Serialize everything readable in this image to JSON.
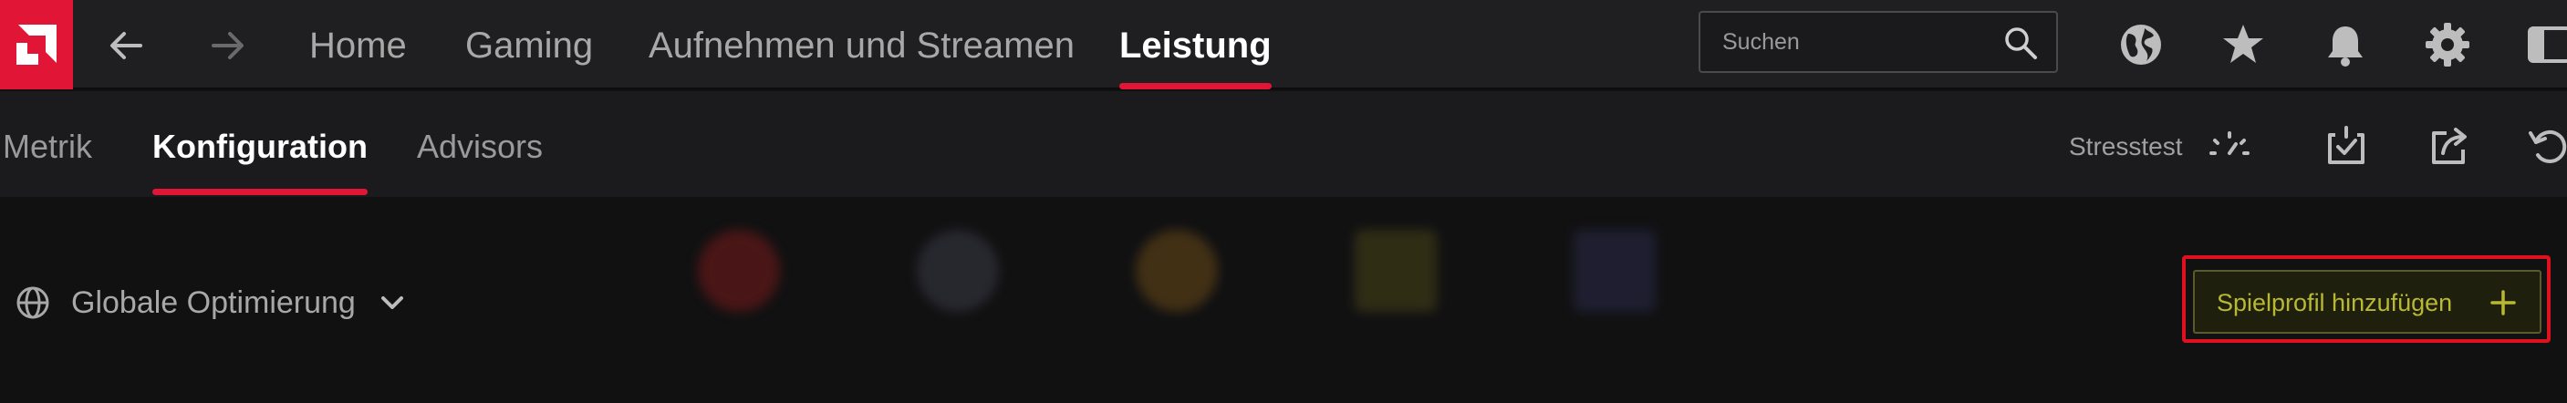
{
  "colors": {
    "accent": "#e11637",
    "add_button_text": "#b9b832",
    "highlight_box": "#e0101e"
  },
  "topnav": {
    "logo": "amd-logo-icon",
    "back": "back-arrow-icon",
    "forward": "forward-arrow-icon",
    "tabs": [
      {
        "label": "Home"
      },
      {
        "label": "Gaming"
      },
      {
        "label": "Aufnehmen und Streamen"
      },
      {
        "label": "Leistung",
        "active": true
      }
    ],
    "search": {
      "placeholder": "Suchen",
      "icon": "search-icon"
    },
    "icons": [
      "globe-icon",
      "star-icon",
      "bell-icon",
      "gear-icon",
      "sidebar-icon"
    ]
  },
  "subnav": {
    "tabs": [
      {
        "label": "Metrik"
      },
      {
        "label": "Konfiguration",
        "active": true
      },
      {
        "label": "Advisors"
      }
    ],
    "stress_label": "Stresstest",
    "icons": [
      "gauge-icon",
      "check-import-icon",
      "export-icon",
      "reset-icon"
    ]
  },
  "content": {
    "scope_label": "Globale Optimierung",
    "add_button_label": "Spielprofil hinzufügen"
  }
}
